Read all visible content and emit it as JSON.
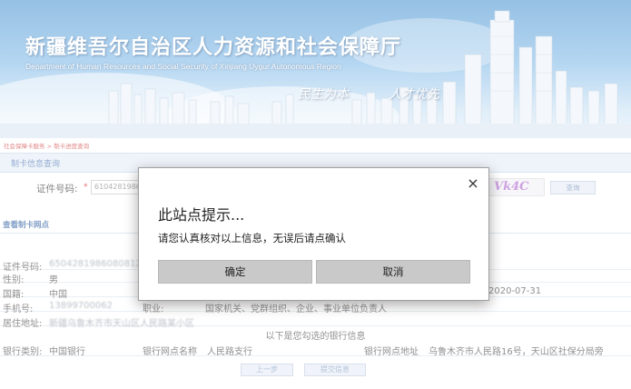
{
  "banner": {
    "title": "新疆维吾尔自治区人力资源和社会保障厅",
    "subtitle": "Department of Human Resources and Social Security of Xinjiang Uygur Autonomous Region",
    "slogan_left": "民生为本",
    "slogan_right": "人才优先"
  },
  "page": {
    "breadcrumb": "社会保障卡服务 > 制卡进度查询",
    "section_title": "制卡信息查询",
    "id_label": "证件号码:",
    "id_value": "6104281986",
    "captcha_text": "Vk4C",
    "query_button": "查询",
    "view_title": "查看制卡网点",
    "rows": {
      "id_label": "证件号码:",
      "id_value": "6504281986080812X",
      "gender_label": "性别:",
      "gender_value": "男",
      "nation_label": "国籍:",
      "nation_value": "中国",
      "date_value": "2020-07-31",
      "phone_label": "手机号:",
      "phone_value": "13899700062",
      "job_label": "职业:",
      "job_value": "国家机关、党群组织、企业、事业单位负责人",
      "address_label": "居住地址:",
      "address_value": "新疆乌鲁木齐市天山区人民路某小区"
    },
    "center_note": "以下是您勾选的银行信息",
    "bank": {
      "category_label": "银行类别:",
      "category_value": "中国银行",
      "branch_label": "银行网点名称",
      "branch_value": "人民路支行",
      "address_label": "银行网点地址",
      "address_value": "乌鲁木齐市人民路16号，天山区社保分局旁"
    },
    "prev_button": "上一步",
    "submit_button": "提交信息"
  },
  "dialog": {
    "title": "此站点提示...",
    "message": "请您认真核对以上信息，无误后请点确认",
    "ok_label": "确定",
    "cancel_label": "取消",
    "close_icon": "×"
  },
  "colors": {
    "banner_sky": "#8cc0ea",
    "dialog_button": "#c9c9c9",
    "required_star": "#e02020"
  }
}
